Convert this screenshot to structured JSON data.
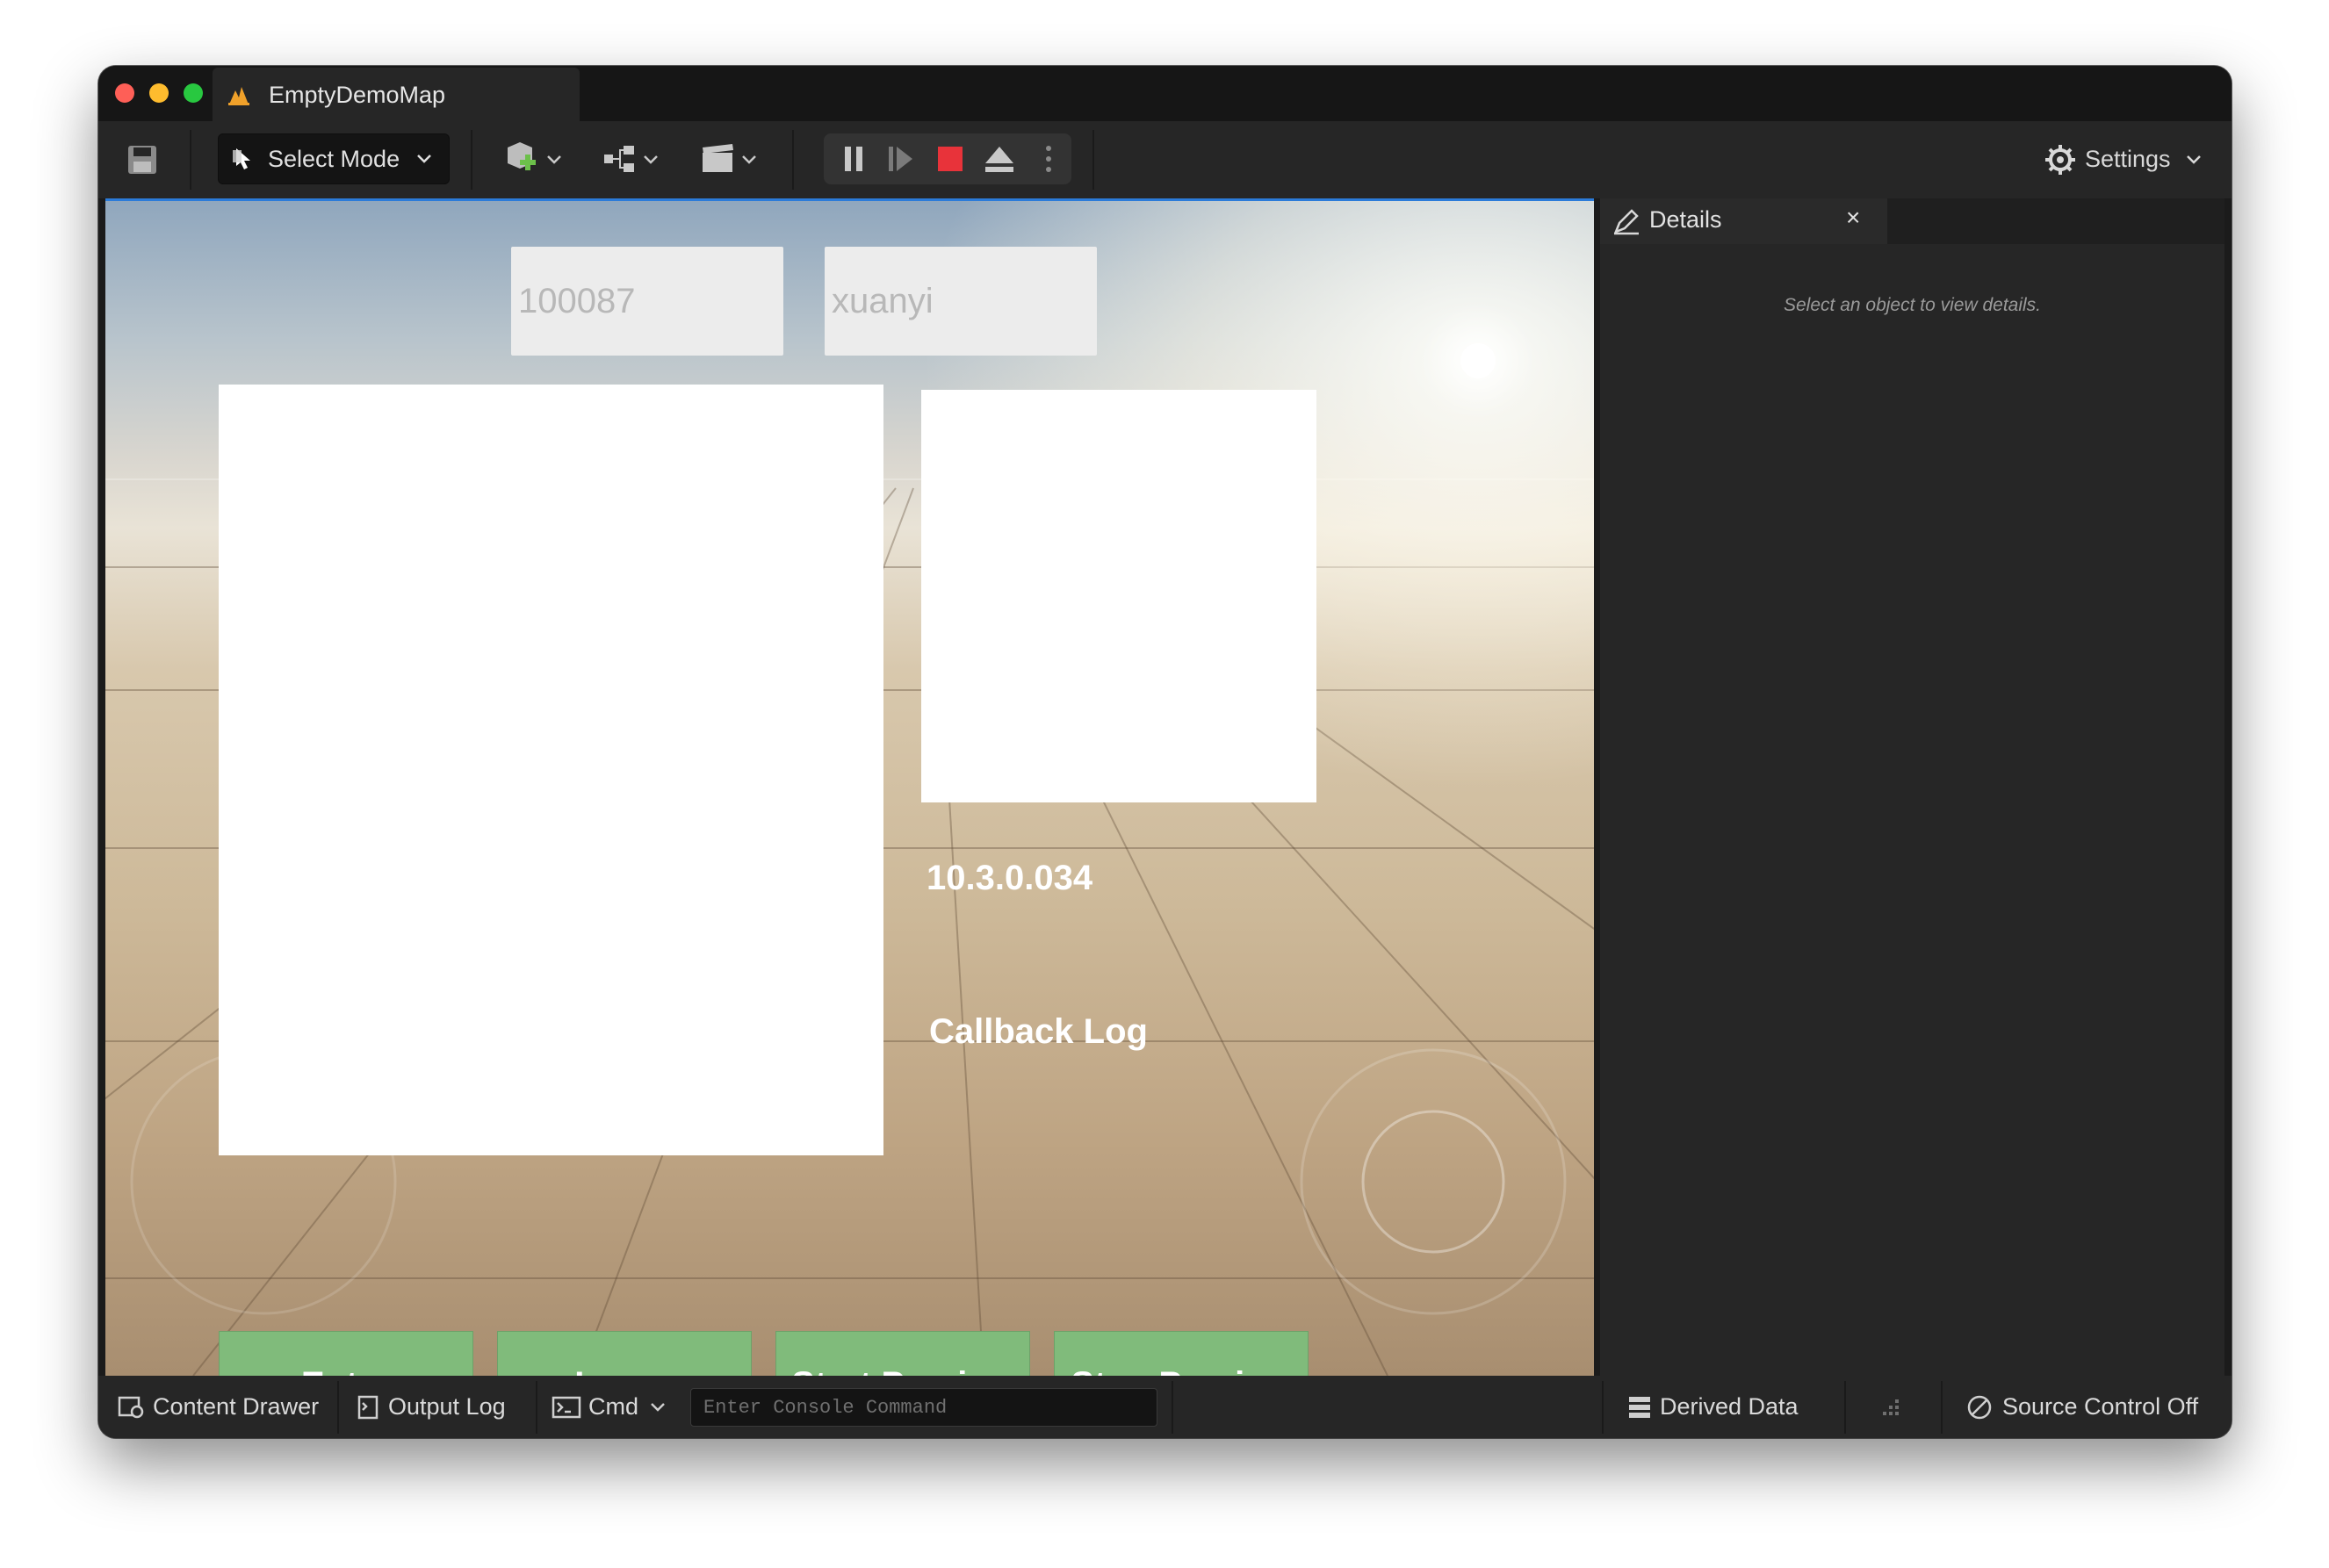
{
  "window": {
    "tab_title": "EmptyDemoMap"
  },
  "toolbar": {
    "select_mode_label": "Select Mode",
    "settings_label": "Settings"
  },
  "viewport": {
    "input_user_id": "100087",
    "input_name": "xuanyi",
    "version_text": "10.3.0.034",
    "callback_log_label": "Callback Log",
    "buttons": {
      "enter": "Enter",
      "leave": "Leave",
      "start_preview": "Start Preview",
      "stop_preview": "Stop Preview"
    },
    "button_color": "#80bb7b"
  },
  "details": {
    "title": "Details",
    "close": "×",
    "hint": "Select an object to view details."
  },
  "statusbar": {
    "content_drawer": "Content Drawer",
    "output_log": "Output Log",
    "cmd": "Cmd",
    "console_placeholder": "Enter Console Command",
    "derived_data": "Derived Data",
    "source_control": "Source Control Off"
  },
  "colors": {
    "accent": "#2b7bd9",
    "stop_red": "#e8333a",
    "add_green": "#6cc04a"
  }
}
